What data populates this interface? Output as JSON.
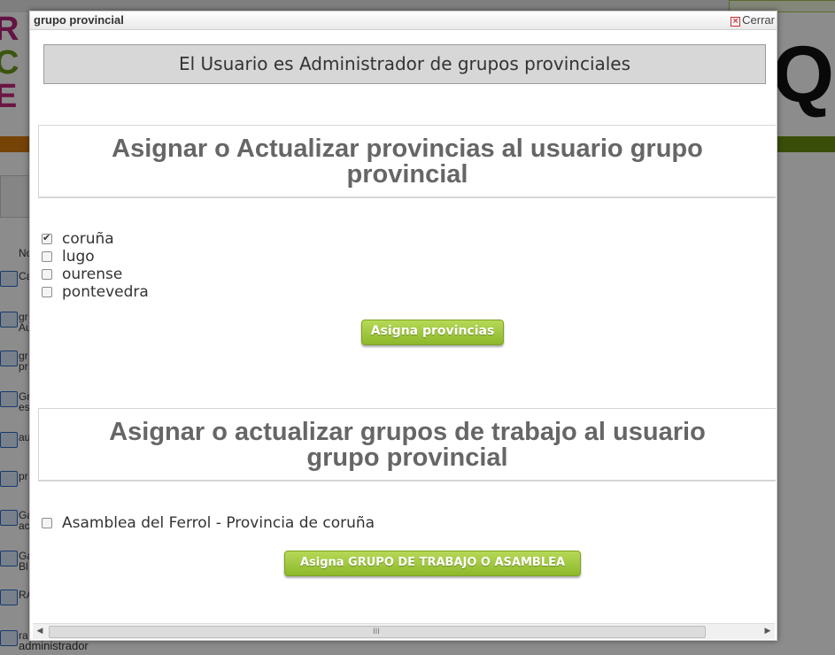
{
  "background": {
    "list_items": [
      "No",
      "Ca",
      "gr",
      "Au",
      "gr",
      "pr",
      "Gr",
      "es",
      "au",
      "pr",
      "Ga",
      "ac",
      "Ga",
      "Bl",
      "RA",
      "ra"
    ],
    "bottom_text": "administrador"
  },
  "dialog": {
    "title": "grupo provincial",
    "close_label": "Cerrar",
    "admin_banner": "El Usuario es Administrador de grupos provinciales",
    "section1": {
      "heading_line1": "Asignar o Actualizar provincias al usuario grupo",
      "heading_line2": "provincial",
      "provinces": [
        {
          "label": "coruña",
          "checked": true
        },
        {
          "label": "lugo",
          "checked": false
        },
        {
          "label": "ourense",
          "checked": false
        },
        {
          "label": "pontevedra",
          "checked": false
        }
      ],
      "button_label": "Asigna provincias"
    },
    "section2": {
      "heading_line1": "Asignar o actualizar grupos de trabajo al usuario",
      "heading_line2": "grupo provincial",
      "groups": [
        {
          "label": "Asamblea del Ferrol - Provincia de coruña",
          "checked": false
        }
      ],
      "button_label": "Asigna GRUPO DE TRABAJO O ASAMBLEA"
    },
    "scrollbar": {
      "grip": "III"
    }
  },
  "colors": {
    "button_green": "#9cc53a",
    "banner_gray": "#d7d7d7",
    "heading_text": "#666666"
  }
}
